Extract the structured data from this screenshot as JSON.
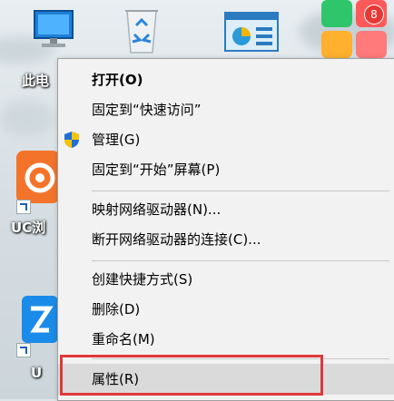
{
  "desktop": {
    "this_pc_label": "此电",
    "uc_label": "UC浏",
    "partial_label": "U",
    "notification_badge": "8"
  },
  "context_menu": {
    "items": [
      {
        "label": "打开(O)",
        "bold": true
      },
      {
        "label": "固定到“快速访问”"
      },
      {
        "label": "管理(G)",
        "icon": "uac-shield-icon"
      },
      {
        "label": "固定到“开始”屏幕(P)"
      },
      {
        "label": "映射网络驱动器(N)..."
      },
      {
        "label": "断开网络驱动器的连接(C)..."
      },
      {
        "label": "创建快捷方式(S)"
      },
      {
        "label": "删除(D)"
      },
      {
        "label": "重命名(M)"
      },
      {
        "label": "属性(R)",
        "highlighted": true
      }
    ]
  },
  "colors": {
    "annotation_border": "#e0393a",
    "menu_background": "#f2f2f2",
    "hover_background": "#dadada"
  }
}
